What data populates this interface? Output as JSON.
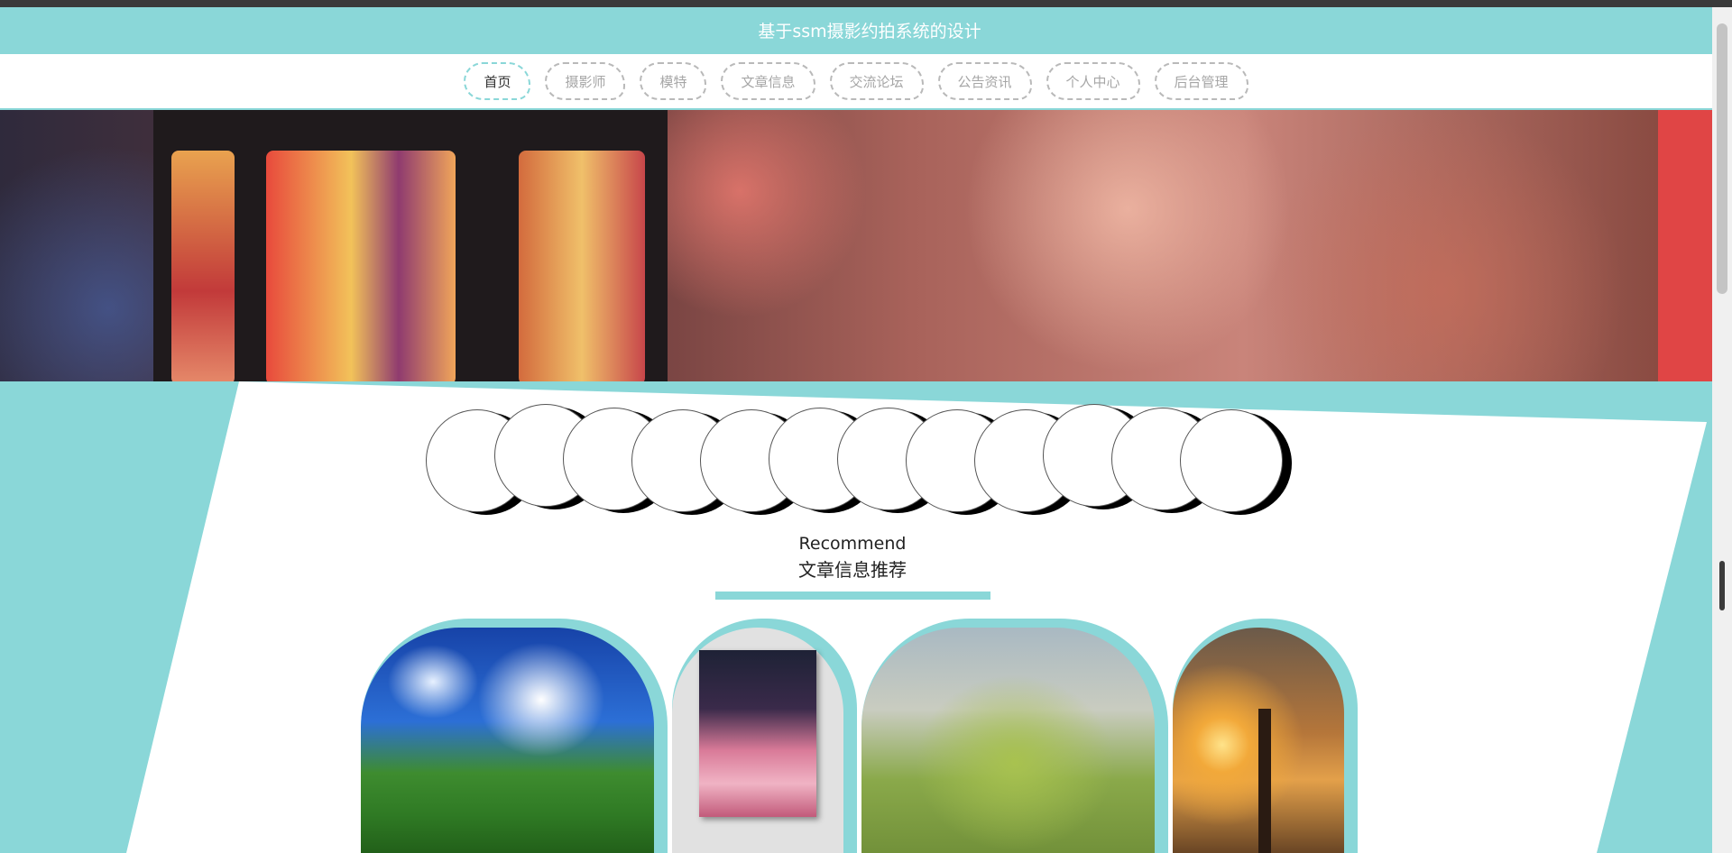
{
  "header": {
    "site_title": "基于ssm摄影约拍系统的设计"
  },
  "nav": {
    "items": [
      {
        "label": "首页",
        "active": true
      },
      {
        "label": "摄影师",
        "active": false
      },
      {
        "label": "模特",
        "active": false
      },
      {
        "label": "文章信息",
        "active": false
      },
      {
        "label": "交流论坛",
        "active": false
      },
      {
        "label": "公告资讯",
        "active": false
      },
      {
        "label": "个人中心",
        "active": false
      },
      {
        "label": "后台管理",
        "active": false
      }
    ]
  },
  "recommend": {
    "title_en": "Recommend",
    "title_cn": "文章信息推荐"
  },
  "colors": {
    "accent": "#8ad7d8",
    "banner_red": "#e04545",
    "text": "#222222"
  },
  "icons": {
    "banner_image": "lantern-bokeh-photo",
    "carousel_dots": "circle-placeholder"
  }
}
